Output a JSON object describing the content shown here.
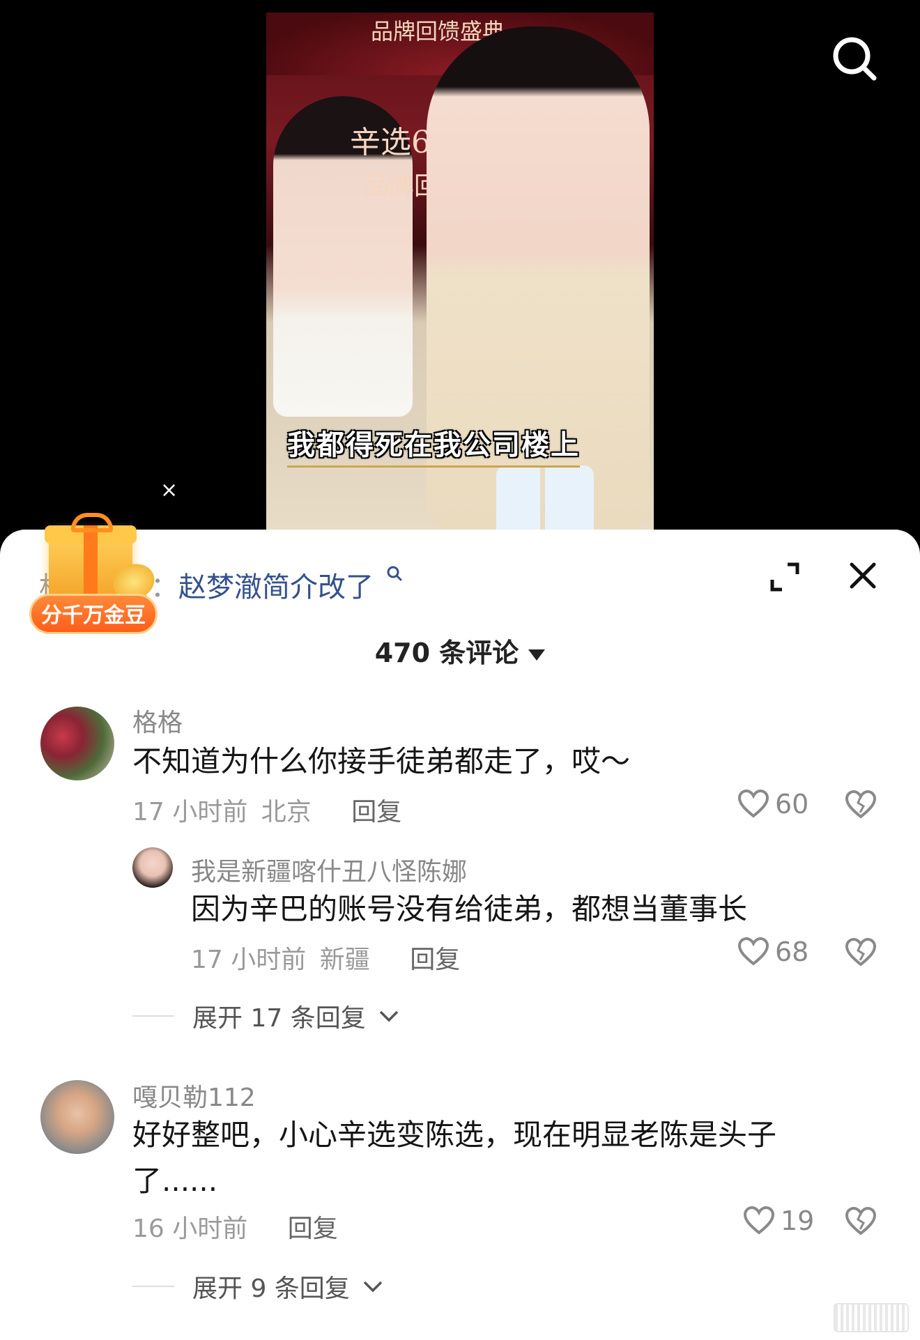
{
  "video": {
    "banner_title": "品牌回馈盛典",
    "banner_mid": "辛选618",
    "banner_mid2": "品牌回馈盛典",
    "subtitle": "我都得死在我公司楼上",
    "close_glyph": "×"
  },
  "sheet": {
    "search_prefix": "相关搜索：",
    "search_query": "赵梦澈简介改了",
    "gift_label": "分千万金豆",
    "comment_count": "470 条评论"
  },
  "comments": [
    {
      "user": "格格",
      "text": "不知道为什么你接手徒弟都走了，哎～",
      "time": "17 小时前",
      "location": "北京",
      "reply_label": "回复",
      "likes": "60",
      "replies": [
        {
          "user": "我是新疆喀什丑八怪陈娜",
          "text": "因为辛巴的账号没有给徒弟，都想当董事长",
          "time": "17 小时前",
          "location": "新疆",
          "reply_label": "回复",
          "likes": "68"
        }
      ],
      "expand_label": "展开 17 条回复"
    },
    {
      "user": "嘎贝勒112",
      "text_line1": "好好整吧，小心辛选变陈选，现在明显老陈是头子",
      "text_line2": "了......",
      "time": "16 小时前",
      "reply_label": "回复",
      "likes": "19",
      "expand_label": "展开 9 条回复"
    }
  ],
  "colors": {
    "sheet_bg": "#ffffff",
    "search_query": "#34518c",
    "gift_orange": "#ff5e1a"
  },
  "icons": [
    "search-icon",
    "close-icon",
    "expand-icon",
    "heart-icon",
    "broken-heart-icon",
    "chevron-down-icon",
    "gift-icon"
  ]
}
